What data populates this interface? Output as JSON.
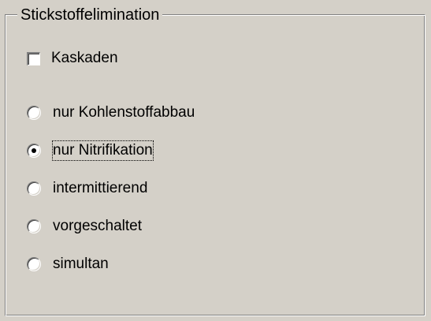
{
  "group": {
    "title": "Stickstoffelimination"
  },
  "checkbox": {
    "label": "Kaskaden",
    "checked": false
  },
  "radio_options": [
    {
      "label": "nur Kohlenstoffabbau",
      "selected": false
    },
    {
      "label": "nur Nitrifikation",
      "selected": true
    },
    {
      "label": "intermittierend",
      "selected": false
    },
    {
      "label": "vorgeschaltet",
      "selected": false
    },
    {
      "label": "simultan",
      "selected": false
    }
  ],
  "colors": {
    "face": "#d4d0c8",
    "shadow": "#808080",
    "highlight": "#ffffff"
  }
}
